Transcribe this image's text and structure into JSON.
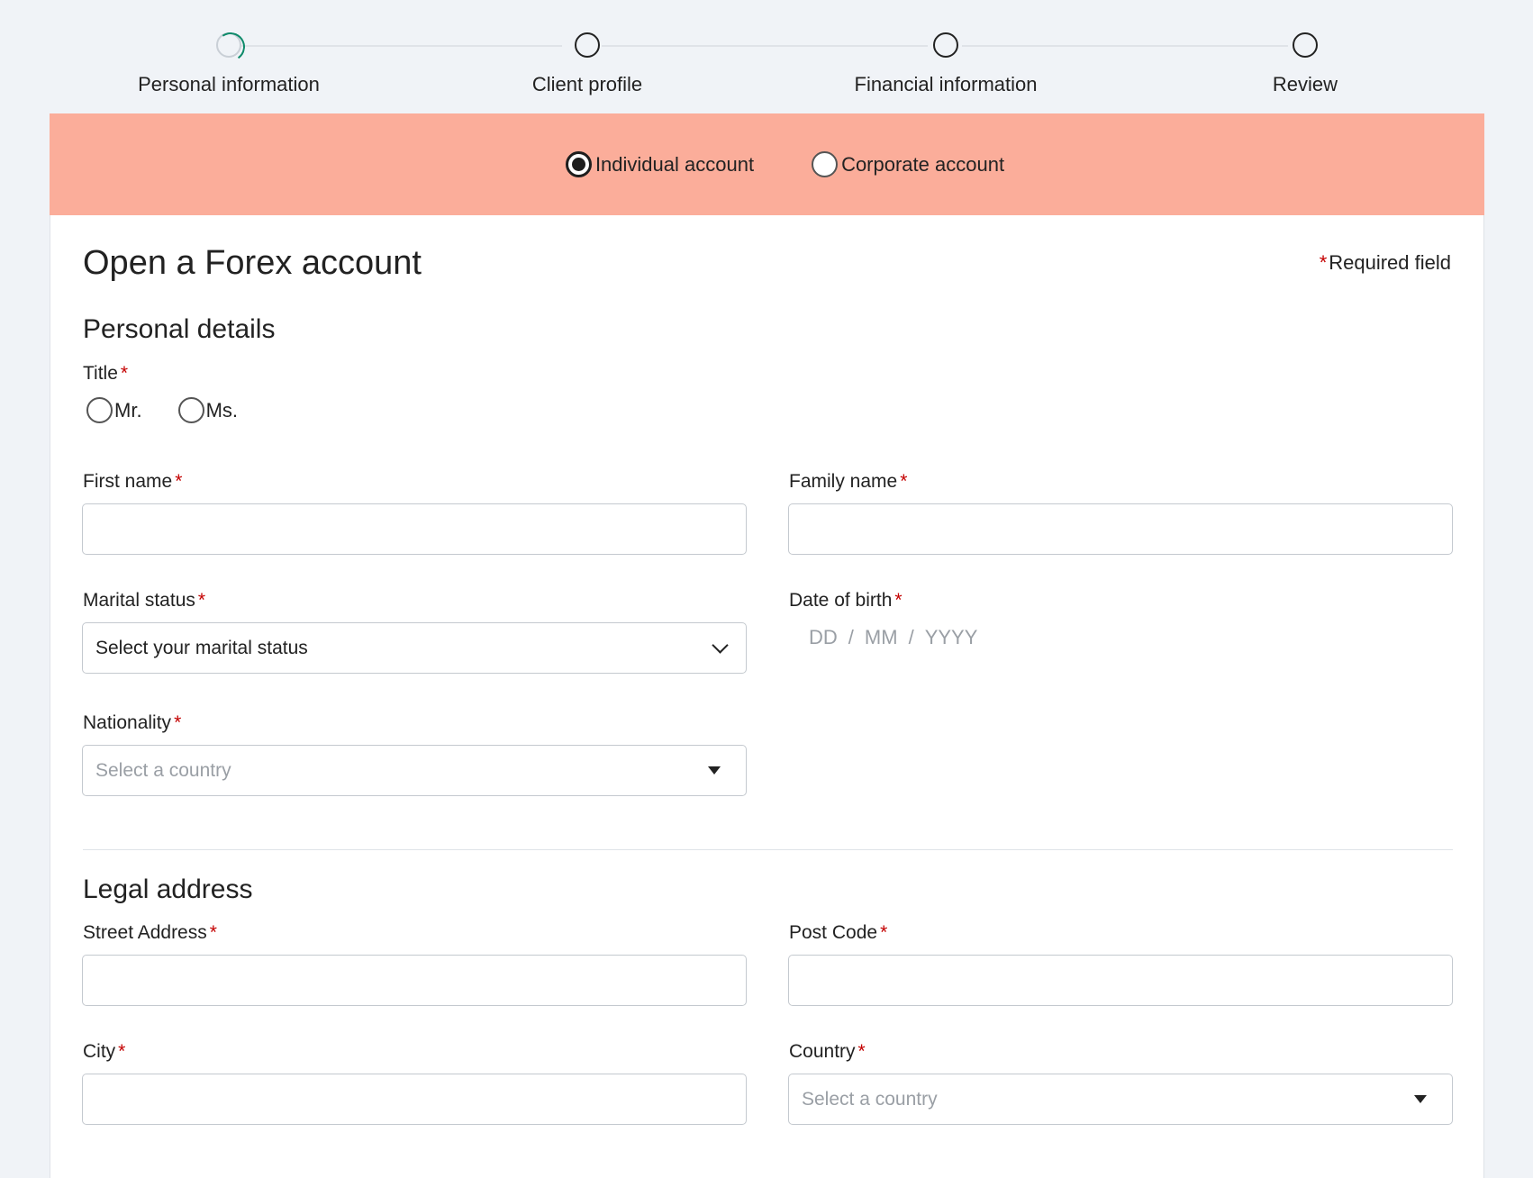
{
  "stepper": {
    "steps": [
      {
        "label": "Personal information",
        "state": "in-progress"
      },
      {
        "label": "Client profile",
        "state": "pending"
      },
      {
        "label": "Financial information",
        "state": "pending"
      },
      {
        "label": "Review",
        "state": "pending"
      }
    ]
  },
  "account_type": {
    "options": [
      {
        "label": "Individual account",
        "checked": true
      },
      {
        "label": "Corporate account",
        "checked": false
      }
    ]
  },
  "form": {
    "title": "Open a Forex account",
    "required_note": "Required field",
    "required_marker": "*",
    "personal_details": {
      "heading": "Personal details",
      "title_label": "Title",
      "title_options": [
        "Mr.",
        "Ms."
      ],
      "first_name_label": "First name",
      "first_name_value": "",
      "family_name_label": "Family name",
      "family_name_value": "",
      "marital_status_label": "Marital status",
      "marital_status_value": "Select your marital status",
      "dob_label": "Date of birth",
      "dob_day": "DD",
      "dob_sep1": "/",
      "dob_month": "MM",
      "dob_sep2": "/",
      "dob_year": "YYYY",
      "nationality_label": "Nationality",
      "nationality_placeholder": "Select a country"
    },
    "legal_address": {
      "heading": "Legal address",
      "street_label": "Street Address",
      "street_value": "",
      "postcode_label": "Post Code",
      "postcode_value": "",
      "city_label": "City",
      "city_value": "",
      "country_label": "Country",
      "country_placeholder": "Select a country"
    }
  },
  "colors": {
    "banner": "#fbad9a",
    "required": "#c40000",
    "progress": "#0e8a6a"
  }
}
